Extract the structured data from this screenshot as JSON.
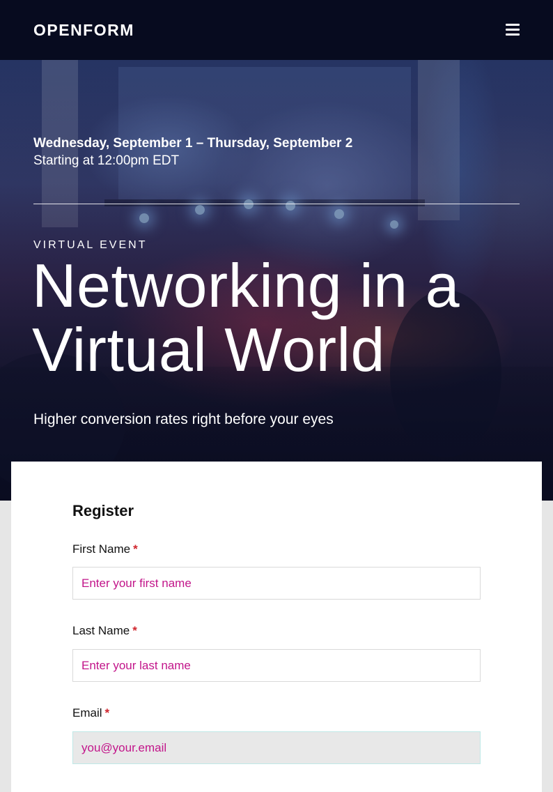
{
  "header": {
    "logo": "OPENFORM",
    "menu_icon": "hamburger-menu-icon"
  },
  "hero": {
    "dates": "Wednesday, September 1 – Thursday, September 2",
    "start_time": "Starting at 12:00pm EDT",
    "eyebrow": "VIRTUAL EVENT",
    "title_line1": "Networking in a",
    "title_line2": "Virtual World",
    "subtitle": "Higher conversion rates right before your eyes"
  },
  "form": {
    "title": "Register",
    "required_marker": "*",
    "fields": [
      {
        "label": "First Name",
        "placeholder": "Enter your first name",
        "value": ""
      },
      {
        "label": "Last Name",
        "placeholder": "Enter your last name",
        "value": ""
      },
      {
        "label": "Email",
        "placeholder": "you@your.email",
        "value": ""
      }
    ]
  },
  "colors": {
    "header_bg": "#070b1f",
    "accent_placeholder": "#c2158a",
    "required": "#d0252d"
  }
}
